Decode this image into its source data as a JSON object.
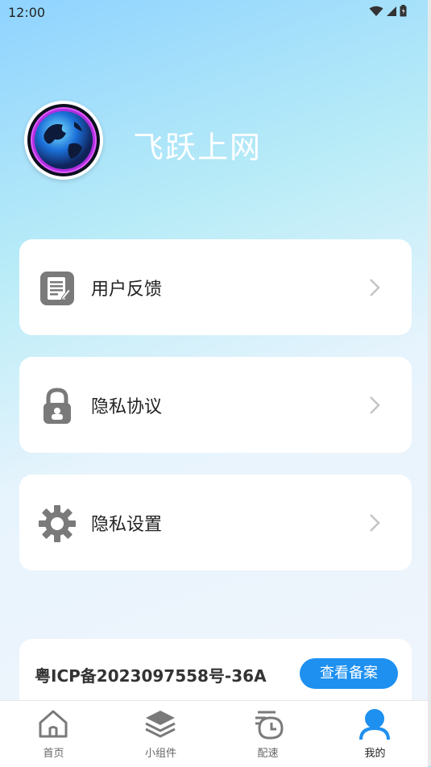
{
  "status": {
    "time": "12:00"
  },
  "profile": {
    "app_name": "飞跃上网"
  },
  "menu": [
    {
      "label": "用户反馈",
      "icon": "feedback-doc-icon"
    },
    {
      "label": "隐私协议",
      "icon": "lock-icon"
    },
    {
      "label": "隐私设置",
      "icon": "gear-icon"
    }
  ],
  "icp": {
    "text": "粤ICP备2023097558号-36A",
    "button_label": "查看备案"
  },
  "nav": [
    {
      "label": "首页",
      "icon": "home-icon"
    },
    {
      "label": "小组件",
      "icon": "layers-icon"
    },
    {
      "label": "配速",
      "icon": "speed-history-icon"
    },
    {
      "label": "我的",
      "icon": "user-icon",
      "active": true
    }
  ],
  "colors": {
    "accent": "#1e90f0",
    "icon_gray": "#7a7a7a"
  }
}
